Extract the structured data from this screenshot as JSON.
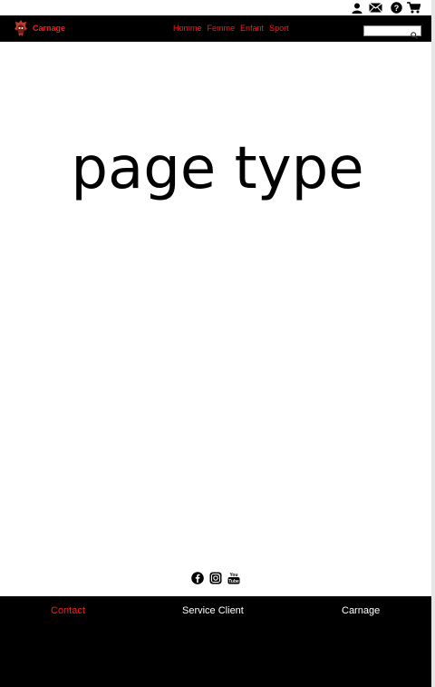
{
  "header": {
    "utility_icons": [
      "user-icon",
      "mail-icon",
      "help-icon",
      "cart-icon"
    ],
    "brand": "Carnage",
    "nav": [
      "Homme",
      "Femme",
      "Enfant",
      "Sport"
    ],
    "search": {
      "placeholder": "",
      "icon": "search-icon"
    }
  },
  "main": {
    "title": "page type"
  },
  "social_icons": [
    "facebook-icon",
    "instagram-icon",
    "youtube-icon"
  ],
  "footer": {
    "links": [
      "Contact",
      "Service Client",
      "Carnage"
    ]
  },
  "colors": {
    "accent": "#ff1a1a",
    "nav_bg": "#000000",
    "footer_bg": "#000000"
  }
}
